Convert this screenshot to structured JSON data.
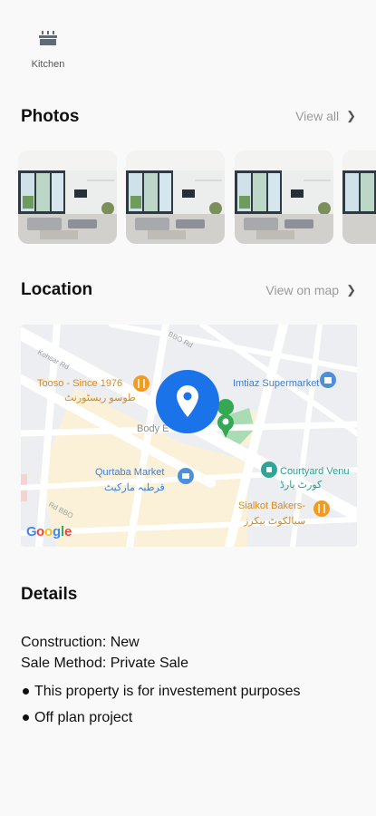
{
  "amenity": {
    "label": "Kitchen",
    "icon": "kitchen-icon"
  },
  "photos": {
    "title": "Photos",
    "view_all": "View all",
    "items": [
      "living-room-photo",
      "living-room-photo",
      "living-room-photo",
      "living-room-photo"
    ]
  },
  "location": {
    "title": "Location",
    "view_map": "View on map",
    "map": {
      "labels": {
        "tooso_en": "Tooso - Since 1976",
        "tooso_ur": "طوسو ریسٹورنٹ",
        "imtiaz": "Imtiaz Supermarket",
        "body": "Body E",
        "qurtaba_en": "Qurtaba Market",
        "qurtaba_ur": "قرطبہ مارکیٹ",
        "courtyard_en": "Courtyard Venu",
        "courtyard_ur": "کورٹ یارڈ",
        "sialkot_en": "Sialkot Bakers-",
        "sialkot_ur": "سیالکوٹ بیکرز",
        "road1": "Kohsar Rd",
        "road2": "BBO Rd",
        "road3": "Rd BBO",
        "google": "Google"
      },
      "accent": "#1a73e8"
    }
  },
  "details": {
    "title": "Details",
    "construction": "Construction: New",
    "sale_method": "Sale Method:  Private Sale",
    "bullets": [
      "This property is for investement purposes",
      "Off plan project"
    ]
  }
}
